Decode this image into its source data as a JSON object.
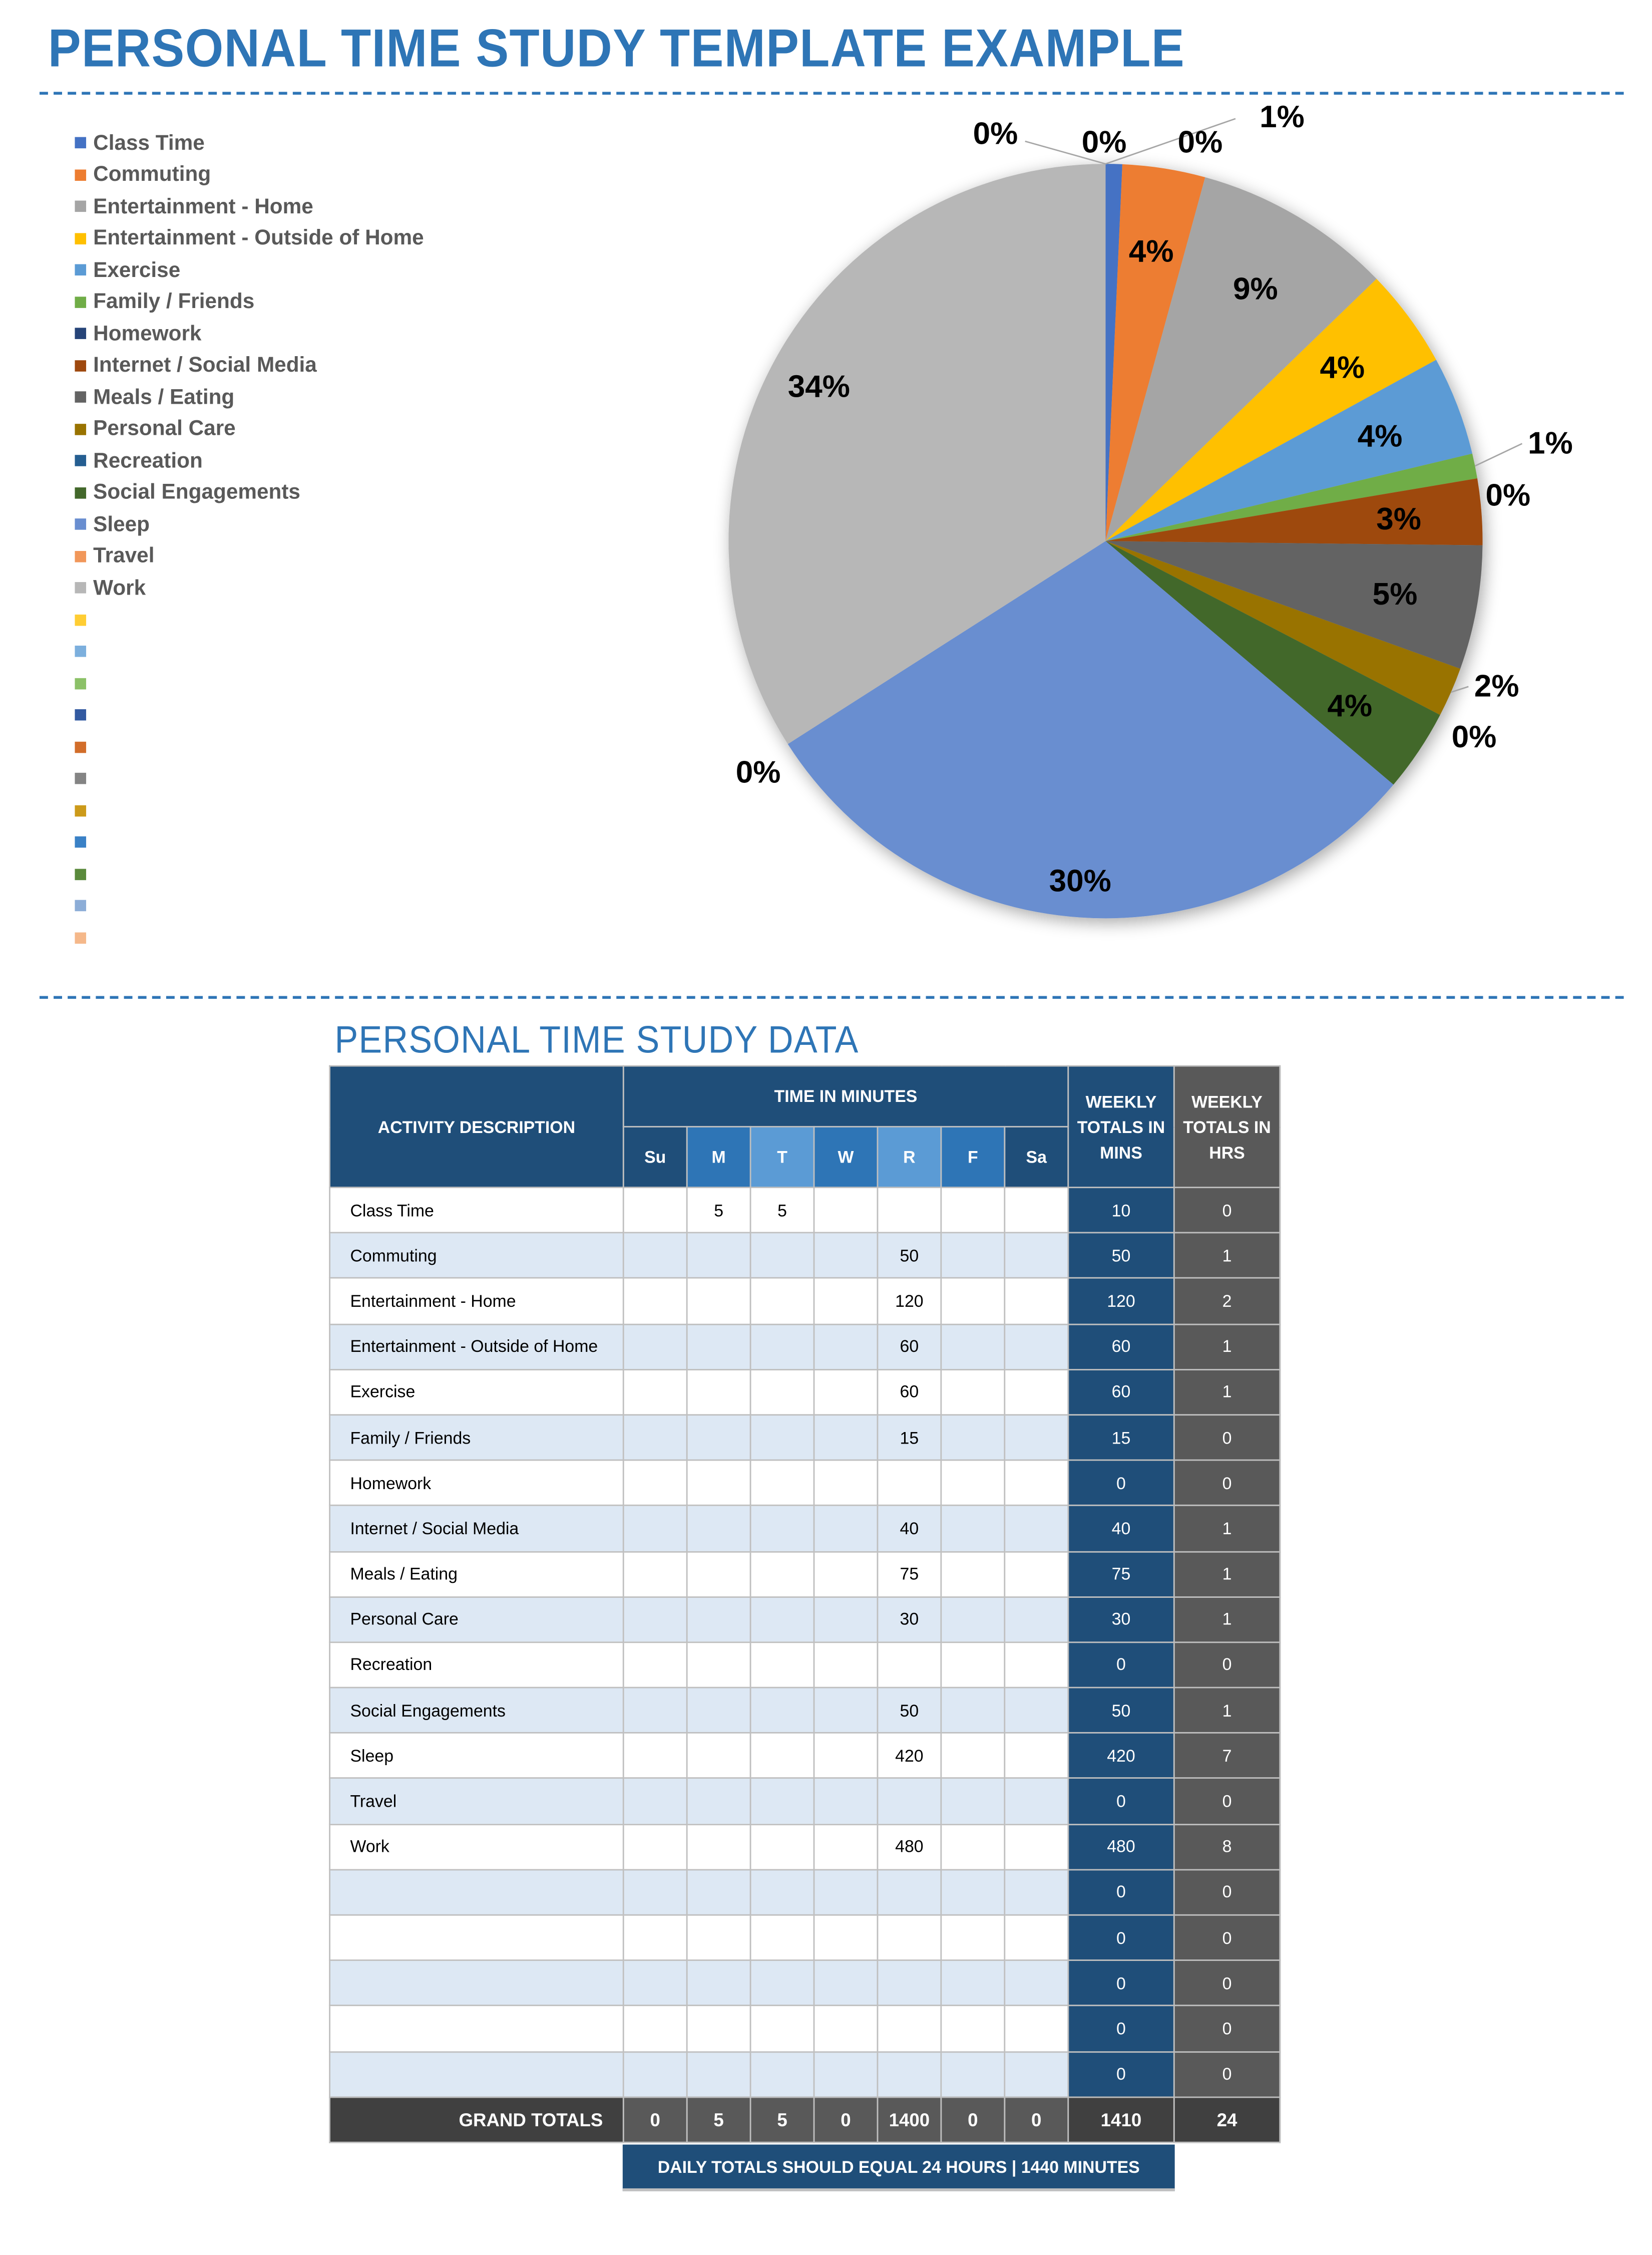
{
  "page": {
    "title": "PERSONAL TIME STUDY TEMPLATE EXAMPLE",
    "data_section_title": "PERSONAL TIME STUDY DATA",
    "note": "DAILY TOTALS SHOULD EQUAL 24 HOURS  |  1440 MINUTES"
  },
  "legend": {
    "items": [
      {
        "label": "Class Time",
        "color": "#4472c4"
      },
      {
        "label": "Commuting",
        "color": "#ed7d31"
      },
      {
        "label": "Entertainment - Home",
        "color": "#a5a5a5"
      },
      {
        "label": "Entertainment - Outside of Home",
        "color": "#ffc000"
      },
      {
        "label": "Exercise",
        "color": "#5b9bd5"
      },
      {
        "label": "Family / Friends",
        "color": "#70ad47"
      },
      {
        "label": "Homework",
        "color": "#264478"
      },
      {
        "label": "Internet / Social Media",
        "color": "#9e480e"
      },
      {
        "label": "Meals / Eating",
        "color": "#636363"
      },
      {
        "label": "Personal Care",
        "color": "#997300"
      },
      {
        "label": "Recreation",
        "color": "#255e91"
      },
      {
        "label": "Social Engagements",
        "color": "#43682b"
      },
      {
        "label": "Sleep",
        "color": "#698ed0"
      },
      {
        "label": "Travel",
        "color": "#f1975a"
      },
      {
        "label": "Work",
        "color": "#b7b7b7"
      },
      {
        "label": "",
        "color": "#ffcd33"
      },
      {
        "label": "",
        "color": "#7cafdd"
      },
      {
        "label": "",
        "color": "#8cc168"
      },
      {
        "label": "",
        "color": "#335aa1"
      },
      {
        "label": "",
        "color": "#d26d2a"
      },
      {
        "label": "",
        "color": "#848484"
      },
      {
        "label": "",
        "color": "#cc9a1a"
      },
      {
        "label": "",
        "color": "#3a81c6"
      },
      {
        "label": "",
        "color": "#5a8a3c"
      },
      {
        "label": "",
        "color": "#8cadd7"
      },
      {
        "label": "",
        "color": "#f5b88a"
      }
    ]
  },
  "chart_data": {
    "type": "pie",
    "title": "",
    "legend_position": "left",
    "categories": [
      "Class Time",
      "Commuting",
      "Entertainment - Home",
      "Entertainment - Outside of Home",
      "Exercise",
      "Family / Friends",
      "Homework",
      "Internet / Social Media",
      "Meals / Eating",
      "Personal Care",
      "Recreation",
      "Social Engagements",
      "Sleep",
      "Travel",
      "Work"
    ],
    "values": [
      10,
      50,
      120,
      60,
      60,
      15,
      0,
      40,
      75,
      30,
      0,
      50,
      420,
      0,
      480
    ],
    "data_labels": [
      "1%",
      "4%",
      "9%",
      "4%",
      "4%",
      "1%",
      "0%",
      "3%",
      "5%",
      "2%",
      "0%",
      "4%",
      "30%",
      "0%",
      "34%"
    ],
    "extra_zero_labels": [
      "0%",
      "0%",
      "0%"
    ],
    "start_angle": "12 o'clock, clockwise"
  },
  "table": {
    "headers": {
      "activity": "ACTIVITY DESCRIPTION",
      "time_group": "TIME IN MINUTES",
      "days": [
        "Su",
        "M",
        "T",
        "W",
        "R",
        "F",
        "Sa"
      ],
      "weekly_mins": "WEEKLY TOTALS IN MINS",
      "weekly_hrs": "WEEKLY TOTALS IN HRS"
    },
    "rows": [
      {
        "activity": "Class Time",
        "days": [
          "",
          "5",
          "5",
          "",
          "",
          "",
          ""
        ],
        "mins": "10",
        "hrs": "0"
      },
      {
        "activity": "Commuting",
        "days": [
          "",
          "",
          "",
          "",
          "50",
          "",
          ""
        ],
        "mins": "50",
        "hrs": "1"
      },
      {
        "activity": "Entertainment - Home",
        "days": [
          "",
          "",
          "",
          "",
          "120",
          "",
          ""
        ],
        "mins": "120",
        "hrs": "2"
      },
      {
        "activity": "Entertainment - Outside of Home",
        "days": [
          "",
          "",
          "",
          "",
          "60",
          "",
          ""
        ],
        "mins": "60",
        "hrs": "1"
      },
      {
        "activity": "Exercise",
        "days": [
          "",
          "",
          "",
          "",
          "60",
          "",
          ""
        ],
        "mins": "60",
        "hrs": "1"
      },
      {
        "activity": "Family / Friends",
        "days": [
          "",
          "",
          "",
          "",
          "15",
          "",
          ""
        ],
        "mins": "15",
        "hrs": "0"
      },
      {
        "activity": "Homework",
        "days": [
          "",
          "",
          "",
          "",
          "",
          "",
          ""
        ],
        "mins": "0",
        "hrs": "0"
      },
      {
        "activity": "Internet / Social Media",
        "days": [
          "",
          "",
          "",
          "",
          "40",
          "",
          ""
        ],
        "mins": "40",
        "hrs": "1"
      },
      {
        "activity": "Meals / Eating",
        "days": [
          "",
          "",
          "",
          "",
          "75",
          "",
          ""
        ],
        "mins": "75",
        "hrs": "1"
      },
      {
        "activity": "Personal Care",
        "days": [
          "",
          "",
          "",
          "",
          "30",
          "",
          ""
        ],
        "mins": "30",
        "hrs": "1"
      },
      {
        "activity": "Recreation",
        "days": [
          "",
          "",
          "",
          "",
          "",
          "",
          ""
        ],
        "mins": "0",
        "hrs": "0"
      },
      {
        "activity": "Social Engagements",
        "days": [
          "",
          "",
          "",
          "",
          "50",
          "",
          ""
        ],
        "mins": "50",
        "hrs": "1"
      },
      {
        "activity": "Sleep",
        "days": [
          "",
          "",
          "",
          "",
          "420",
          "",
          ""
        ],
        "mins": "420",
        "hrs": "7"
      },
      {
        "activity": "Travel",
        "days": [
          "",
          "",
          "",
          "",
          "",
          "",
          ""
        ],
        "mins": "0",
        "hrs": "0"
      },
      {
        "activity": "Work",
        "days": [
          "",
          "",
          "",
          "",
          "480",
          "",
          ""
        ],
        "mins": "480",
        "hrs": "8"
      },
      {
        "activity": "",
        "days": [
          "",
          "",
          "",
          "",
          "",
          "",
          ""
        ],
        "mins": "0",
        "hrs": "0"
      },
      {
        "activity": "",
        "days": [
          "",
          "",
          "",
          "",
          "",
          "",
          ""
        ],
        "mins": "0",
        "hrs": "0"
      },
      {
        "activity": "",
        "days": [
          "",
          "",
          "",
          "",
          "",
          "",
          ""
        ],
        "mins": "0",
        "hrs": "0"
      },
      {
        "activity": "",
        "days": [
          "",
          "",
          "",
          "",
          "",
          "",
          ""
        ],
        "mins": "0",
        "hrs": "0"
      },
      {
        "activity": "",
        "days": [
          "",
          "",
          "",
          "",
          "",
          "",
          ""
        ],
        "mins": "0",
        "hrs": "0"
      }
    ],
    "grand_totals": {
      "label": "GRAND TOTALS",
      "days": [
        "0",
        "5",
        "5",
        "0",
        "1400",
        "0",
        "0"
      ],
      "mins": "1410",
      "hrs": "24"
    }
  }
}
